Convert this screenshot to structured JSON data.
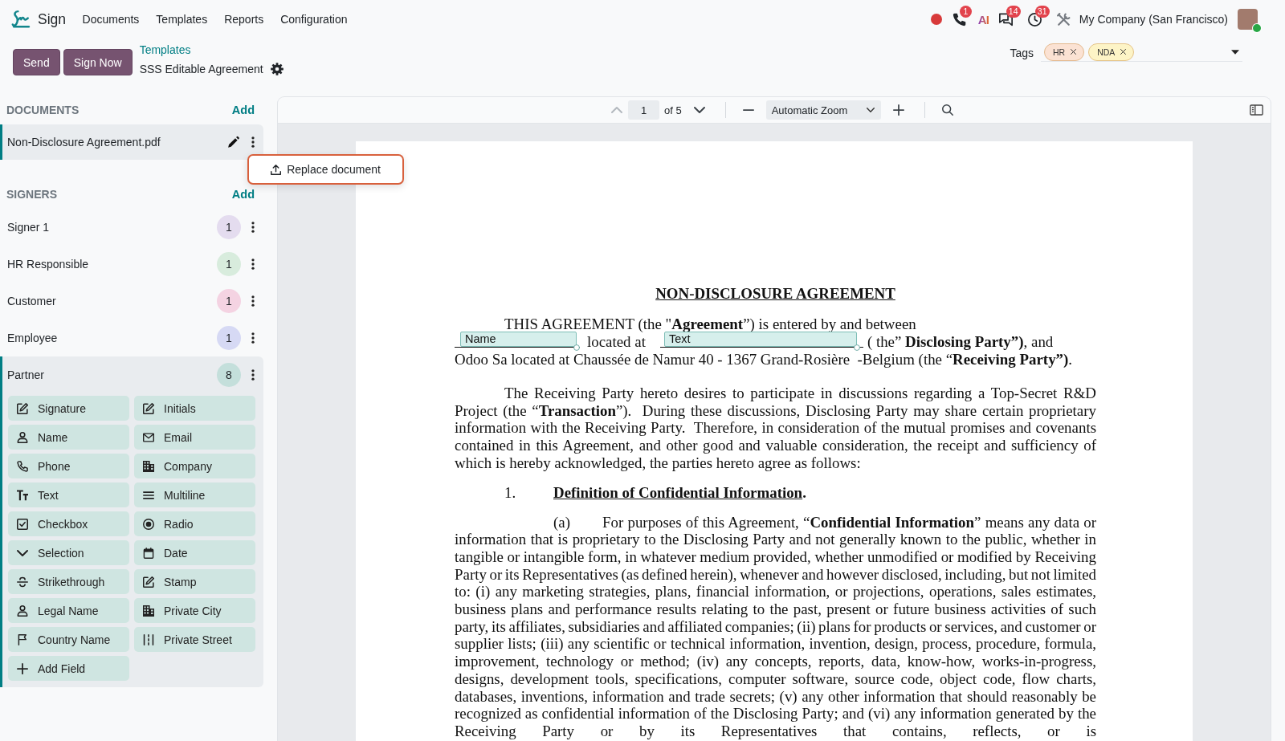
{
  "navbar": {
    "app_name": "Sign",
    "menu": [
      {
        "label": "Documents"
      },
      {
        "label": "Templates"
      },
      {
        "label": "Reports"
      },
      {
        "label": "Configuration"
      }
    ],
    "systray": [
      {
        "kind": "record"
      },
      {
        "kind": "phone",
        "badge": "1"
      },
      {
        "kind": "ai",
        "label": "AI"
      },
      {
        "kind": "chat",
        "badge": "14"
      },
      {
        "kind": "activity",
        "badge": "31"
      },
      {
        "kind": "tools"
      }
    ],
    "company": "My Company (San Francisco)",
    "user": {
      "online": true
    }
  },
  "control_panel": {
    "buttons": [
      "Send",
      "Sign Now"
    ],
    "breadcrumb": "Templates",
    "title": "SSS Editable Agreement",
    "tags": {
      "label": "Tags",
      "items": [
        {
          "label": "HR",
          "color": "#fbe2d3"
        },
        {
          "label": "NDA",
          "color": "#fdf4c6"
        }
      ]
    }
  },
  "documents": {
    "heading": "DOCUMENTS",
    "add": "Add",
    "items": [
      {
        "name": "Non-Disclosure Agreement.pdf",
        "selected": true
      }
    ]
  },
  "document_menu": {
    "items": [
      "Replace document"
    ]
  },
  "signers": {
    "heading": "SIGNERS",
    "add": "Add",
    "items": [
      {
        "name": "Signer 1",
        "count": "1",
        "color": "#e4dcef",
        "selected": false
      },
      {
        "name": "HR Responsible",
        "count": "1",
        "color": "#d8ecdd",
        "selected": false
      },
      {
        "name": "Customer",
        "count": "1",
        "color": "#f4d3e2",
        "selected": false
      },
      {
        "name": "Employee",
        "count": "1",
        "color": "#d6d9f4",
        "selected": false
      },
      {
        "name": "Partner",
        "count": "8",
        "color": "#c4dfdb",
        "selected": true,
        "fields": [
          {
            "label": "Signature",
            "kind": "signature"
          },
          {
            "label": "Initials",
            "kind": "initials"
          },
          {
            "label": "Name",
            "kind": "name"
          },
          {
            "label": "Email",
            "kind": "email"
          },
          {
            "label": "Phone",
            "kind": "phone"
          },
          {
            "label": "Company",
            "kind": "company"
          },
          {
            "label": "Text",
            "kind": "text"
          },
          {
            "label": "Multiline",
            "kind": "multiline"
          },
          {
            "label": "Checkbox",
            "kind": "checkbox"
          },
          {
            "label": "Radio",
            "kind": "radio"
          },
          {
            "label": "Selection",
            "kind": "selection"
          },
          {
            "label": "Date",
            "kind": "date"
          },
          {
            "label": "Strikethrough",
            "kind": "strikethrough"
          },
          {
            "label": "Stamp",
            "kind": "stamp"
          },
          {
            "label": "Legal Name",
            "kind": "legal"
          },
          {
            "label": "Private City",
            "kind": "city"
          },
          {
            "label": "Country Name",
            "kind": "country"
          },
          {
            "label": "Private Street",
            "kind": "street"
          },
          {
            "label": "Add Field",
            "kind": "add"
          }
        ]
      }
    ]
  },
  "viewer": {
    "page": "1",
    "page_count": "of 5",
    "previous": {
      "disabled": true
    },
    "next": {
      "disabled": false
    },
    "zoom": "Automatic Zoom"
  },
  "document": {
    "title": "NON-DISCLOSURE AGREEMENT",
    "intro": {
      "opening": "THIS AGREEMENT (the \"**Agreement**”) is entered by and between",
      "party_line": [
        {
          "kind": "blank",
          "field": "Name"
        },
        {
          "kind": "text",
          "text": "located at"
        },
        {
          "kind": "blank",
          "field": "Text"
        },
        {
          "kind": "text",
          "text": "( the” **Disclosing Party”)**, and"
        }
      ],
      "closing": "Odoo Sa located at Chaussée de Namur 40 - 1367 Grand-Rosière  -Belgium (the “**Receiving Party”)**."
    },
    "paragraph": "The Receiving Party hereto desires to participate in discussions regarding a Top-Secret R&D Project (the “**Transaction**”).  During these discussions, Disclosing Party may share certain proprietary information with the Receiving Party.  Therefore, in consideration of the mutual promises and covenants contained in this Agreement, and other good and valuable consideration, the receipt and sufficiency of which is hereby acknowledged, the parties hereto agree as follows:",
    "section": {
      "number": "1.",
      "title": "Definition of Confidential Information",
      "after": "."
    },
    "clause": {
      "marker": "(a)",
      "text": "For purposes of this Agreement, “**Confidential Information**” means any data or information that is proprietary to the Disclosing Party and not generally known to the public, whether in tangible or intangible form, in whatever medium provided, whether unmodified or modified by Receiving Party or its Representatives (as defined herein), whenever and however disclosed, including, but not limited to: (i) any marketing strategies, plans, financial information, or projections, operations, sales estimates, business plans and performance results relating to the past, present or future business activities of such party, its affiliates, subsidiaries and affiliated companies; (ii) plans for products or services, and customer or supplier lists; (iii) any scientific or technical information, invention, design, process, procedure, formula, improvement, technology or method; (iv) any concepts, reports, data, know-how, works-in-progress, designs, development tools, specifications, computer software, source code, object code, flow charts, databases, inventions, information and trade secrets; (v) any other information that should reasonably be recognized as confidential information of the Disclosing Party; and (vi) any information generated by the Receiving Party or by its Representatives that contains, reflects, or is"
    }
  }
}
